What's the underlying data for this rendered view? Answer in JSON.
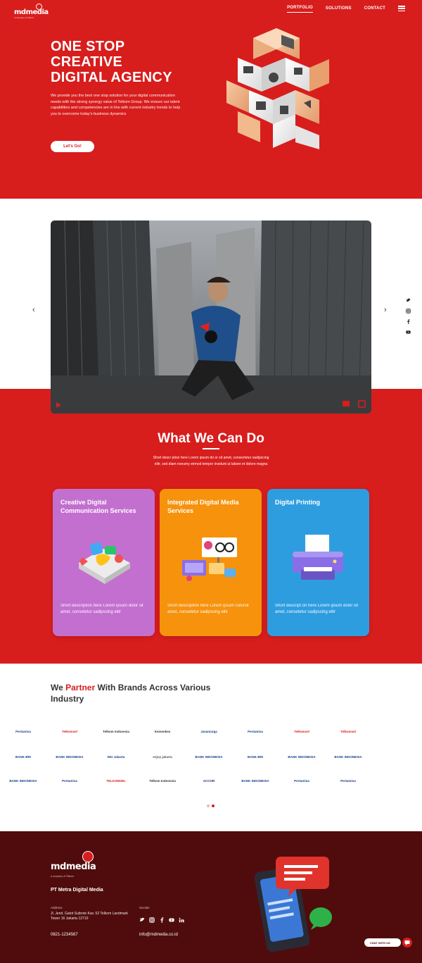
{
  "brand": {
    "logo_text": "mdmedia",
    "tagline": "a company of Telkom",
    "accent": "#d81d1d",
    "dark": "#500c0c"
  },
  "nav": {
    "items": [
      {
        "label": "PORTFOLIO",
        "active": true
      },
      {
        "label": "SOLUTIONS",
        "active": false
      },
      {
        "label": "CONTACT",
        "active": false
      }
    ],
    "menu_icon": "hamburger-icon"
  },
  "hero": {
    "title_line1": "ONE STOP",
    "title_line2": "CREATIVE",
    "title_line3": "DIGITAL AGENCY",
    "description": "We provide you the best one stop solution for your digital communication needs with the strong synergy value of Telkom Group. We ensure our talent capabilities and competencies are in line with current industry trends to help you to overcome today's business dynamics",
    "cta_label": "Let's Go!"
  },
  "video": {
    "prev_icon": "chevron-left-icon",
    "next_icon": "chevron-right-icon",
    "play_icon": "play-icon",
    "mute_icon": "volume-mute-icon",
    "fullscreen_icon": "fullscreen-icon"
  },
  "social_rail": [
    "twitter-icon",
    "instagram-icon",
    "facebook-icon",
    "youtube-icon"
  ],
  "services": {
    "title": "What We Can Do",
    "description": "Short descr ption here Lorem ipsum do or sit amet, consectetur sadipscing elitr, sed diam nonumy eirmod tempor invidunt ut labore et dolore magna",
    "cards": [
      {
        "title": "Creative Digital Communication Services",
        "description": "Short description here Lorem ipsum dolor sit amet, consetetur sadipscing elitr",
        "color": "#c36fd0"
      },
      {
        "title": "Integrated Digital Media Services",
        "description": "Short description here Lorem ipsum colorsit amet, consetetur sadipscing elitr",
        "color": "#f6920c"
      },
      {
        "title": "Digital Printing",
        "description": "Short descript on here Lorem ipsum dolor sit amet, consetetur sadipscing elitr",
        "color": "#2e9de0"
      }
    ]
  },
  "partners": {
    "title_pre": "We ",
    "title_accent": "Partner",
    "title_post": " With Brands Across Various Industry",
    "logos": [
      "Pertamina",
      "Telkomsel",
      "Telkom Indonesia",
      "Kemenkes",
      "Jasamarga",
      "Pertamina",
      "Telkomsel",
      "Telkomsel",
      "BANK BRI",
      "BANK INDONESIA",
      "DKI Jakarta",
      "enjoy jakarta",
      "BANK INDONESIA",
      "BANK BRI",
      "BANK INDONESIA",
      "BANK INDONESIA",
      "BANK INDONESIA",
      "Pertamina",
      "TELKOMSEL",
      "Telkom Indonesia",
      "ACCOR",
      "BANK INDONESIA",
      "Pertamina",
      "Pertamina"
    ],
    "pagination": [
      false,
      true
    ]
  },
  "footer": {
    "logo_text": "mdmedia",
    "tagline": "a company of Telkom",
    "company": "PT Metra Digital Media",
    "address_label": "Address",
    "address": "Jl. Jend. Gatot Subroto Kav. 52 Telkom Landmark Tower 16 Jakarta 12710",
    "socials_label": "Socials",
    "socials": [
      "twitter-icon",
      "instagram-icon",
      "facebook-icon",
      "youtube-icon",
      "linkedin-icon"
    ],
    "phone": "0821-1234567",
    "email": "info@mdmedia.co.id",
    "chat_label": "CHAT WITH US",
    "chat_icon": "chat-icon"
  }
}
